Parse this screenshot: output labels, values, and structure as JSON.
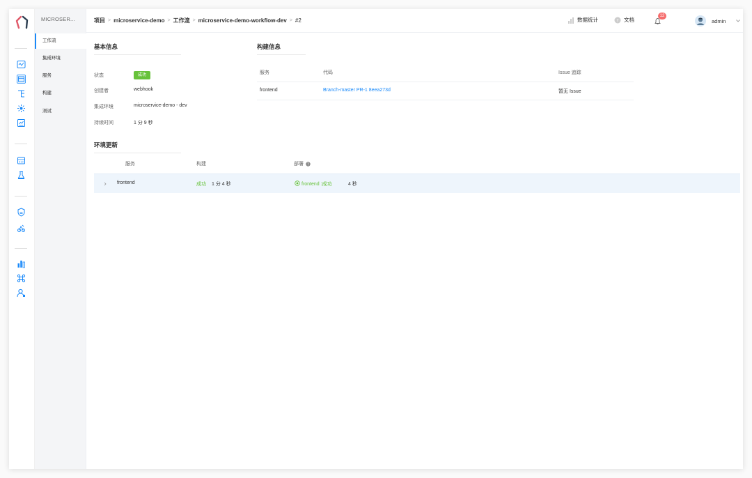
{
  "sidebar": {
    "project_name": "MICROSER...",
    "items": [
      {
        "label": "工作流"
      },
      {
        "label": "集成环境"
      },
      {
        "label": "服务"
      },
      {
        "label": "构建"
      },
      {
        "label": "测试"
      }
    ]
  },
  "rail_icons": [
    "pipeline-icon",
    "workflow-icon",
    "service-icon",
    "build-icon",
    "test-icon",
    "artifact-icon",
    "delivery-icon",
    "security-icon",
    "fleet-icon",
    "dashboard-icon",
    "integration-icon",
    "user-icon"
  ],
  "breadcrumb": {
    "project": "项目",
    "project_name": "microservice-demo",
    "workflow_section": "工作流",
    "workflow_name": "microservice-demo-workflow-dev",
    "task_id": "#2",
    "separator": ">"
  },
  "header": {
    "stats_label": "数据统计",
    "docs_label": "文档",
    "notification_count": "12",
    "username": "admin"
  },
  "basic_info": {
    "title": "基本信息",
    "status_label": "状态",
    "status_value": "成功",
    "creator_label": "创建者",
    "creator_value": "webhook",
    "env_label": "集成环境",
    "env_value": "microservice-demo - dev",
    "duration_label": "持续时间",
    "duration_value": "1 分 9 秒"
  },
  "build_info": {
    "title": "构建信息",
    "columns": [
      "服务",
      "代码",
      "Issue 追踪"
    ],
    "rows": [
      {
        "service": "frontend",
        "code": "Branch-master PR-1 8eea273d",
        "issue": "暂无 Issue"
      }
    ]
  },
  "env_update": {
    "title": "环境更新",
    "columns": [
      "服务",
      "构建",
      "部署"
    ],
    "rows": [
      {
        "service": "frontend",
        "build_status": "成功",
        "build_time": "1 分 4 秒",
        "deploy_status": "frontend :成功",
        "deploy_time": "4 秒"
      }
    ]
  },
  "colors": {
    "accent": "#1989fa",
    "success": "#67c23a",
    "badge": "#f56c6c"
  }
}
